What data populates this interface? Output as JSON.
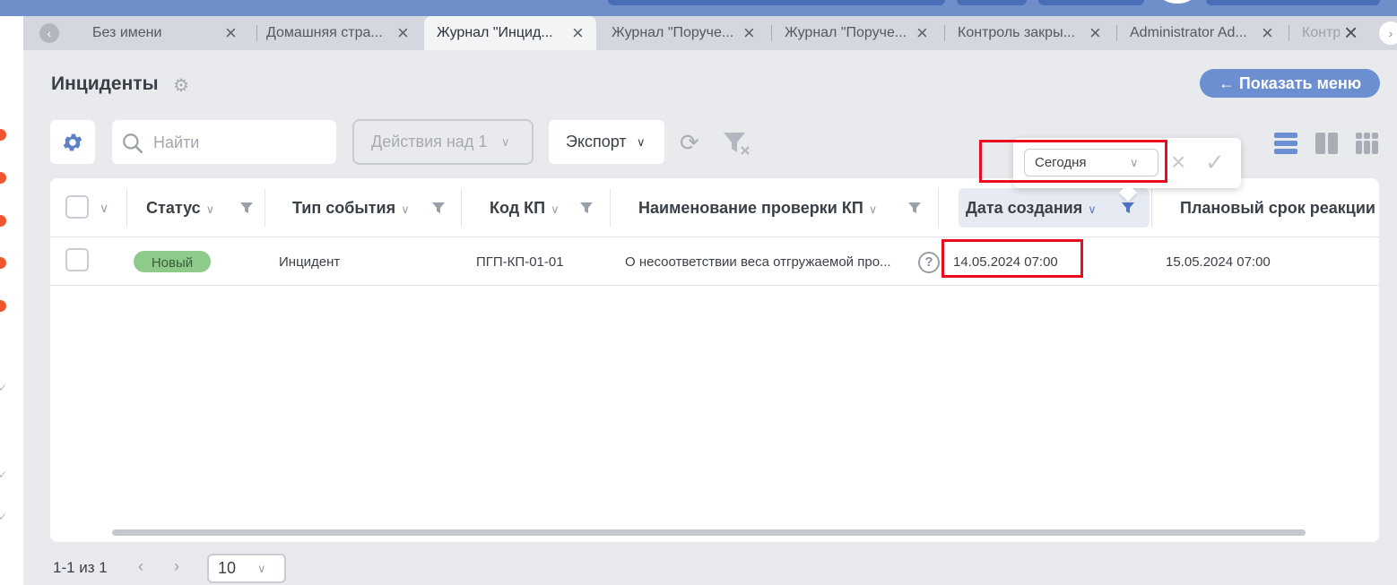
{
  "tabs": [
    {
      "label": "Без имени"
    },
    {
      "label": "Домашняя стра..."
    },
    {
      "label": "Журнал \"Инцид..."
    },
    {
      "label": "Журнал \"Поруче..."
    },
    {
      "label": "Журнал \"Поруче..."
    },
    {
      "label": "Контроль закры..."
    },
    {
      "label": "Administrator Ad..."
    },
    {
      "label": "Контр"
    }
  ],
  "header": {
    "title": "Инциденты",
    "show_menu": "← Показать меню"
  },
  "toolbar": {
    "search_placeholder": "Найти",
    "actions_label": "Действия над 1",
    "export_label": "Экспорт"
  },
  "columns": {
    "status": "Статус",
    "event_type": "Тип события",
    "kp_code": "Код КП",
    "kp_check_name": "Наименование проверки КП",
    "created_date": "Дата создания",
    "planned_deadline": "Плановый срок реакции"
  },
  "rows": [
    {
      "status": "Новый",
      "event_type": "Инцидент",
      "kp_code": "ПГП-КП-01-01",
      "kp_check_name": "О несоответствии веса отгружаемой про...",
      "created_date": "14.05.2024 07:00",
      "planned_deadline": "15.05.2024 07:00"
    }
  ],
  "filter_popup": {
    "selected_period": "Сегодня"
  },
  "pager": {
    "info": "1-1 из 1",
    "page_size": "10"
  },
  "colors": {
    "accent": "#6b8fd1",
    "status_new": "#8ecb8a",
    "highlight": "#ea0b1f"
  }
}
